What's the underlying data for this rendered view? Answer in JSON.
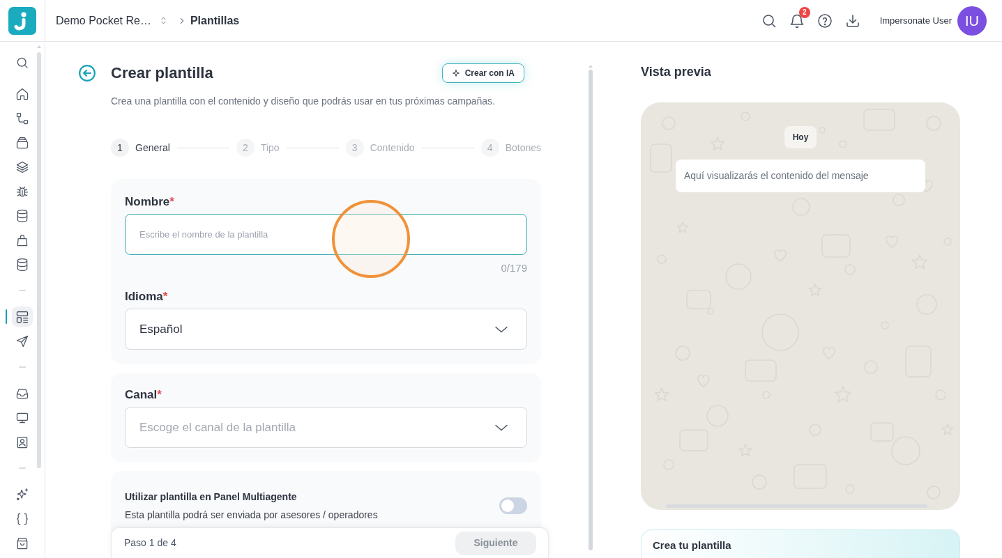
{
  "topbar": {
    "breadcrumb": [
      "Demo Pocket Re…",
      "Plantillas"
    ],
    "notification_count": "2",
    "user": {
      "name": "Impersonate User",
      "initials": "IU"
    }
  },
  "sidebar": {
    "groups": [
      {
        "items": [
          {
            "selected": false
          },
          {
            "selected": false
          },
          {
            "selected": false
          },
          {
            "selected": false
          },
          {
            "selected": false
          },
          {
            "selected": false
          },
          {
            "selected": false
          },
          {
            "selected": false
          },
          {
            "selected": false
          }
        ]
      },
      {
        "items": [
          {
            "selected": true
          },
          {
            "selected": false
          }
        ]
      },
      {
        "items": [
          {
            "selected": false
          },
          {
            "selected": false
          },
          {
            "selected": false
          }
        ]
      },
      {
        "items": [
          {
            "selected": false
          },
          {
            "selected": false
          },
          {
            "selected": false
          }
        ]
      }
    ]
  },
  "form": {
    "title": "Crear plantilla",
    "ai_button": "Crear con IA",
    "subtitle": "Crea una plantilla con el contenido y diseño que podrás usar en tus próximas campañas.",
    "steps": [
      {
        "number": "1",
        "label": "General",
        "selected": true
      },
      {
        "number": "2",
        "label": "Tipo",
        "selected": false
      },
      {
        "number": "3",
        "label": "Contenido",
        "selected": false
      },
      {
        "number": "4",
        "label": "Botones",
        "selected": false
      }
    ],
    "sections": [
      {
        "fields": [
          {
            "kind": "text",
            "label": "Nombre",
            "required_mark": "*",
            "placeholder": "Escribe el nombre de la plantilla",
            "counter": "0/179",
            "focused": true
          },
          {
            "kind": "select",
            "label": "Idioma",
            "required_mark": "*",
            "value": "Español",
            "focused": false
          }
        ]
      },
      {
        "fields": [
          {
            "kind": "select",
            "label": "Canal",
            "required_mark": "*",
            "placeholder": "Escoge el canal de la plantilla",
            "focused": false
          }
        ]
      },
      {
        "fields": [
          {
            "kind": "toggle",
            "label": "Utilizar plantilla en Panel Multiagente",
            "description": "Esta plantilla podrá ser enviada por asesores / operadores",
            "on": false
          }
        ]
      }
    ],
    "footer": {
      "step_text": "Paso 1 de 4",
      "next_button": {
        "label": "Siguiente",
        "disabled": true
      }
    }
  },
  "preview": {
    "title": "Vista previa",
    "date_chip": "Hoy",
    "message": "Aquí visualizarás el contenido del mensaje",
    "promo_title": "Crea tu plantilla"
  }
}
